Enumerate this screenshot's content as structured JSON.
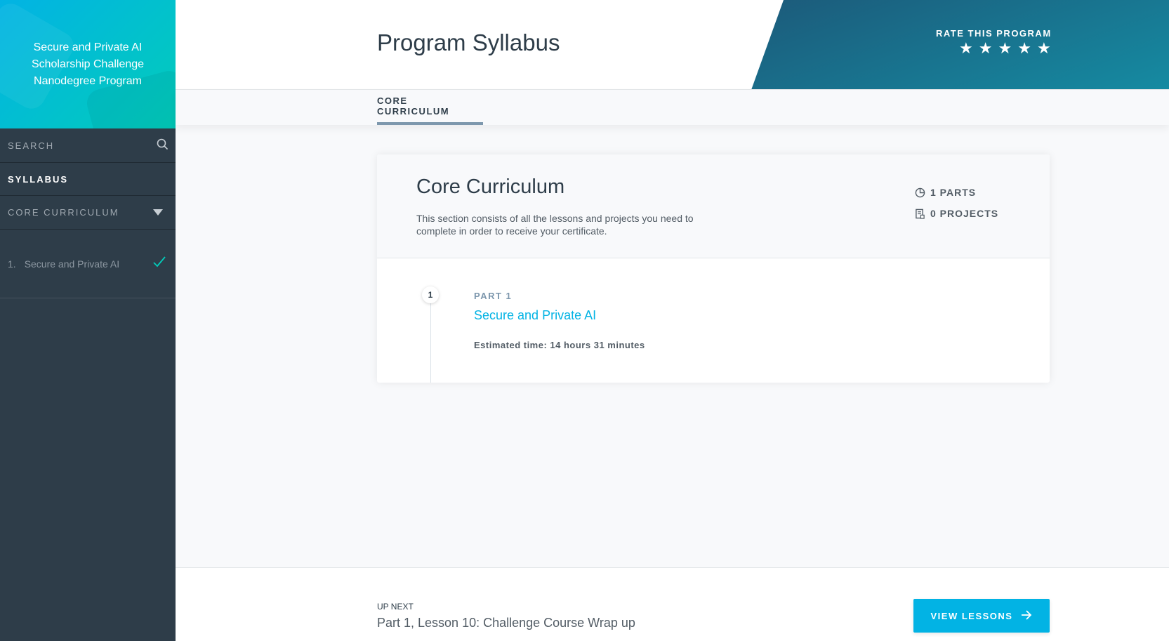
{
  "sidebar": {
    "program_title_line1": "Secure and Private AI",
    "program_title_line2": "Scholarship Challenge",
    "program_title_line3": "Nanodegree Program",
    "search_label": "SEARCH",
    "syllabus_label": "SYLLABUS",
    "core_curriculum_label": "CORE CURRICULUM",
    "lessons": [
      {
        "number": "1.",
        "title": "Secure and Private AI",
        "completed": true
      }
    ]
  },
  "header": {
    "page_title": "Program Syllabus",
    "rate_label": "RATE THIS PROGRAM",
    "rating_stars": 5
  },
  "tabs": [
    {
      "label": "CORE CURRICULUM",
      "active": true
    }
  ],
  "card": {
    "title": "Core Curriculum",
    "description": "This section consists of all the lessons and projects you need to complete in order to receive your certificate.",
    "parts_count": "1 PARTS",
    "projects_count": "0 PROJECTS",
    "parts": [
      {
        "number": "1",
        "label": "PART 1",
        "title": "Secure and Private AI",
        "estimated_time": "Estimated time: 14 hours 31 minutes"
      }
    ]
  },
  "footer": {
    "up_next_label": "UP NEXT",
    "up_next_title": "Part 1, Lesson 10: Challenge Course Wrap up",
    "view_lessons_label": "VIEW LESSONS"
  },
  "colors": {
    "accent": "#02b3e4",
    "sidebar_bg": "#2e3d49",
    "check": "#02ccba",
    "rate_panel": "#1c5a7a"
  }
}
